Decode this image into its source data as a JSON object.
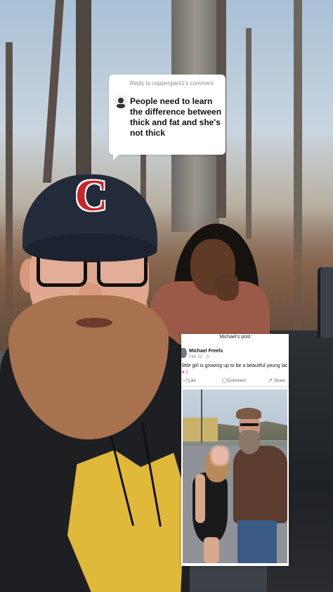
{
  "reply": {
    "header": "Reply to coppergiant1's comment",
    "text": "People need to learn the difference between thick and fat and she's not thick"
  },
  "facebook_post": {
    "title": "Michael's post",
    "author": "Michael Freels",
    "date": "Feb 22 · ",
    "text": "little girl is growing up to be a beautiful young lady",
    "reactions": "2",
    "actions": [
      "Like",
      "Comment",
      "Share"
    ]
  },
  "colors": {
    "cap_logo": "#c8262a",
    "hoodie_print": "#e0b93a",
    "bubble_bg": "#ffffff"
  },
  "cap_logo_text": "C"
}
